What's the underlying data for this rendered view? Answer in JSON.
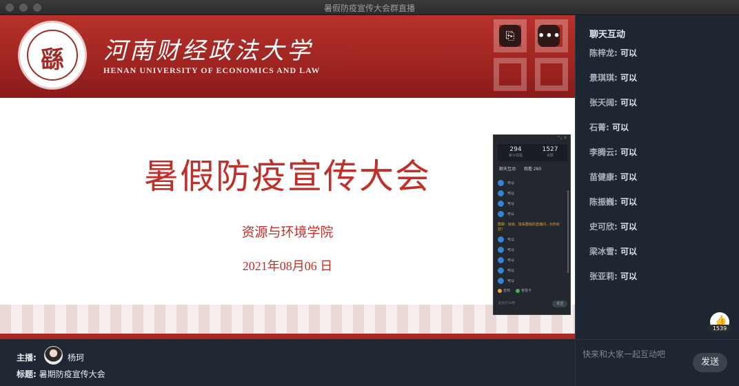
{
  "window": {
    "title": "暑假防疫宣传大会群直播"
  },
  "slide": {
    "university_cn": "河南财经政法大学",
    "university_en": "HENAN UNIVERSITY OF ECONOMICS AND LAW",
    "seal_char": "繇",
    "title": "暑假防疫宣传大会",
    "subtitle": "资源与环境学院",
    "date": "2021年08月06 日"
  },
  "controls": {
    "share_icon": "⎘",
    "more_icon": "•••"
  },
  "mini_window": {
    "stats": [
      {
        "value": "294",
        "label": "累计观看"
      },
      {
        "value": "1527",
        "label": "点赞"
      }
    ],
    "tabs": [
      "聊天互动",
      "观看·280"
    ],
    "rows": [
      {
        "text": "可以",
        "notice": false
      },
      {
        "text": "可以",
        "notice": false
      },
      {
        "text": "可以",
        "notice": false
      },
      {
        "text": "可以",
        "notice": false
      },
      {
        "text": "群聊：班级、院系群组的直播间...为你欢迎！",
        "notice": true
      },
      {
        "text": "可以",
        "notice": false
      },
      {
        "text": "可以",
        "notice": false
      },
      {
        "text": "可以",
        "notice": false
      },
      {
        "text": "可以",
        "notice": false
      },
      {
        "text": "可以",
        "notice": false
      }
    ],
    "tools": [
      "签到",
      "答题卡"
    ],
    "input_placeholder": "说点什么吧",
    "send_label": "发送"
  },
  "host": {
    "host_label": "主播:",
    "host_name": "杨珂",
    "title_label": "标题:",
    "title_value": "暑期防疫宣传大会"
  },
  "chat": {
    "header": "聊天互动",
    "messages": [
      {
        "user": "陈梓龙:",
        "text": "可以"
      },
      {
        "user": "景琪琪:",
        "text": "可以"
      },
      {
        "user": "张天阔:",
        "text": "可以"
      },
      {
        "user": "石菁:",
        "text": "可以"
      },
      {
        "user": "李腾云:",
        "text": "可以"
      },
      {
        "user": "苗健康:",
        "text": "可以"
      },
      {
        "user": "陈振巍:",
        "text": "可以"
      },
      {
        "user": "史可欣:",
        "text": "可以"
      },
      {
        "user": "梁冰雪:",
        "text": "可以"
      },
      {
        "user": "张亚莉:",
        "text": "可以"
      }
    ],
    "like_count": "1539",
    "input_placeholder": "快来和大家一起互动吧",
    "send_label": "发送"
  }
}
